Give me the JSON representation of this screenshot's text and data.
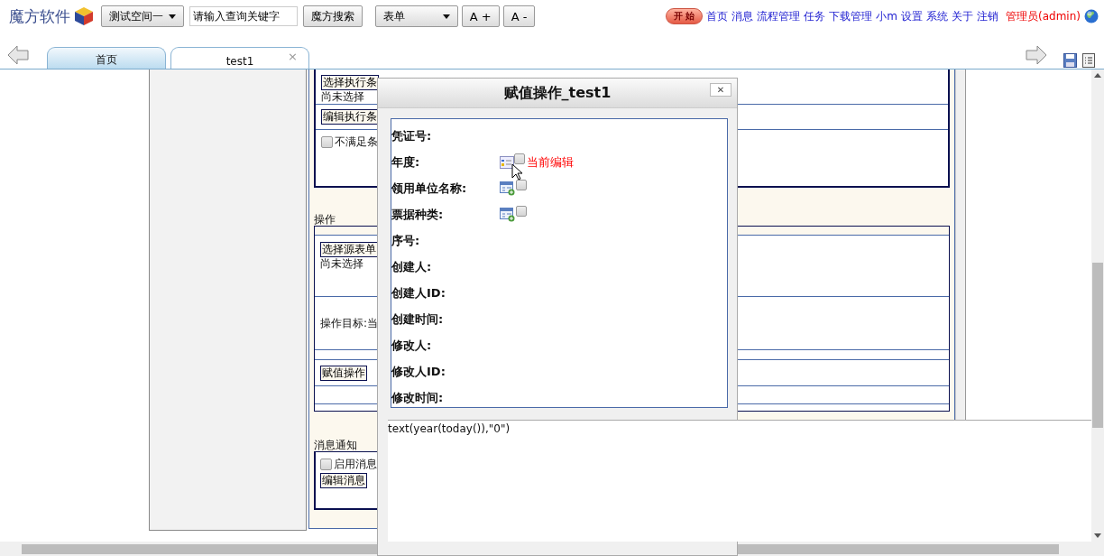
{
  "header": {
    "logo": "魔方软件",
    "space_menu": "测试空间一",
    "search": {
      "value": "请输入查询关键字"
    },
    "search_button": "魔方搜索",
    "type_select": "表单",
    "font_buttons": [
      "A +",
      "A -"
    ],
    "start_button": "开 始",
    "nav_links": [
      "首页",
      "消息",
      "流程管理",
      "任务",
      "下载管理",
      "小m",
      "设置",
      "系统",
      "关于",
      "注销"
    ],
    "user": "管理员(admin)"
  },
  "tabs": [
    {
      "label": "首页",
      "selected": false
    },
    {
      "label": "test1",
      "selected": true,
      "close": "×"
    }
  ],
  "form": {
    "condition": {
      "select_button": "选择执行条",
      "select_status": "尚未选择",
      "edit_button": "编辑执行条",
      "unmet": {
        "label": "不满足条",
        "checked": false
      }
    },
    "action": {
      "legend": "操作",
      "source_button": "选择源表单",
      "source_status": "尚未选择",
      "target": "操作目标:当",
      "assign_button": "赋值操作"
    },
    "notify": {
      "legend": "消息通知",
      "enable": {
        "label": "启用消息",
        "checked": false
      },
      "edit_button": "编辑消息"
    }
  },
  "dialog": {
    "title": "赋值操作_test1",
    "close": "✕",
    "fields": [
      {
        "label": "凭证号:",
        "kind": "plain"
      },
      {
        "label": "年度:",
        "kind": "current",
        "checked": false,
        "note": "当前编辑"
      },
      {
        "label": "领用单位名称:",
        "kind": "add",
        "checked": false
      },
      {
        "label": "票据种类:",
        "kind": "add",
        "checked": false
      },
      {
        "label": "序号:",
        "kind": "plain"
      },
      {
        "label": "创建人:",
        "kind": "plain"
      },
      {
        "label": "创建人ID:",
        "kind": "plain"
      },
      {
        "label": "创建时间:",
        "kind": "plain"
      },
      {
        "label": "修改人:",
        "kind": "plain"
      },
      {
        "label": "修改人ID:",
        "kind": "plain"
      },
      {
        "label": "修改时间:",
        "kind": "plain"
      }
    ]
  },
  "formula": "text(year(today()),\"0\")"
}
